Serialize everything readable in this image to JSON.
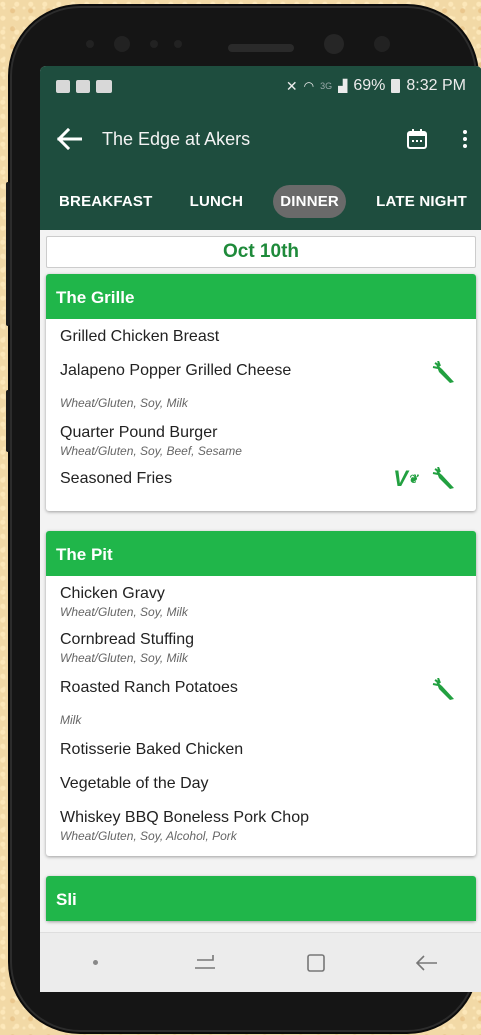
{
  "status": {
    "battery": "69%",
    "time": "8:32 PM",
    "network": "3G"
  },
  "appbar": {
    "title": "The Edge at Akers"
  },
  "tabs": [
    {
      "label": "BREAKFAST",
      "active": false
    },
    {
      "label": "LUNCH",
      "active": false
    },
    {
      "label": "DINNER",
      "active": true
    },
    {
      "label": "LATE NIGHT",
      "active": false
    }
  ],
  "date": "Oct 10th",
  "stations": [
    {
      "name": "The Grille",
      "items": [
        {
          "name": "Grilled Chicken Breast",
          "allergens": ""
        },
        {
          "name": "Jalapeno Popper Grilled Cheese",
          "allergens": "Wheat/Gluten, Soy, Milk",
          "badges": [
            "vegetarian"
          ]
        },
        {
          "name": "Quarter Pound Burger",
          "allergens": "Wheat/Gluten, Soy, Beef, Sesame"
        },
        {
          "name": "Seasoned Fries",
          "allergens": "",
          "badges": [
            "vegan",
            "vegetarian"
          ]
        }
      ]
    },
    {
      "name": "The Pit",
      "items": [
        {
          "name": "Chicken Gravy",
          "allergens": "Wheat/Gluten, Soy, Milk"
        },
        {
          "name": "Cornbread Stuffing",
          "allergens": "Wheat/Gluten, Soy, Milk"
        },
        {
          "name": "Roasted Ranch Potatoes",
          "allergens": "Milk",
          "badges": [
            "vegetarian"
          ]
        },
        {
          "name": "Rotisserie Baked Chicken",
          "allergens": ""
        },
        {
          "name": "Vegetable of the Day",
          "allergens": ""
        },
        {
          "name": "Whiskey BBQ Boneless Pork Chop",
          "allergens": "Wheat/Gluten, Soy, Alcohol, Pork"
        }
      ]
    },
    {
      "name": "Sli",
      "items": []
    }
  ],
  "colors": {
    "brand_dark": "#1e4d3e",
    "header_green": "#20b64a",
    "icon_green": "#22a040"
  },
  "icons": {
    "vegetarian": "carrot-icon",
    "vegan": "vegan-v-icon"
  }
}
